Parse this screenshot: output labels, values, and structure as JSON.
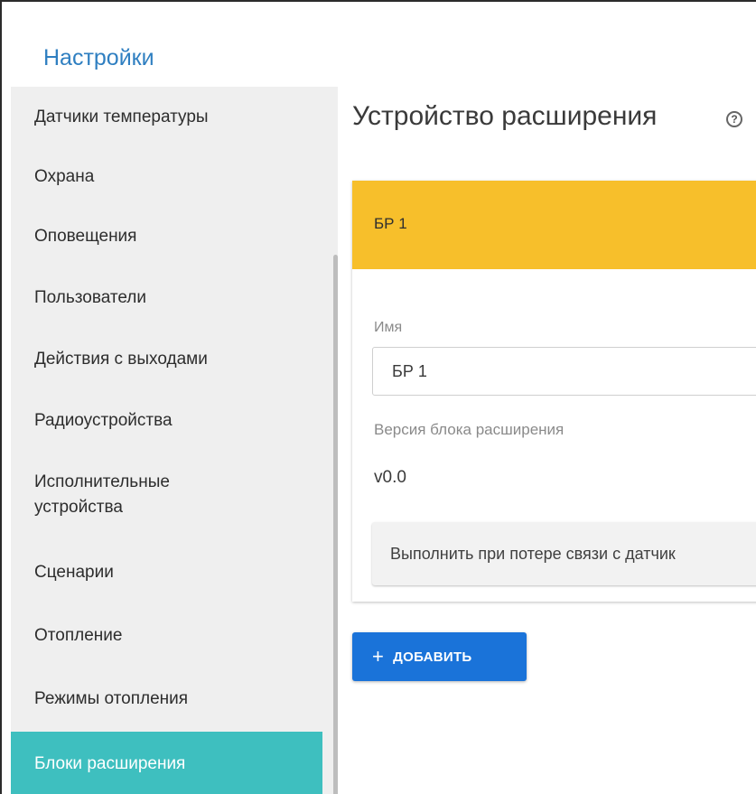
{
  "header": {
    "title": "Настройки"
  },
  "sidebar": {
    "items": [
      {
        "label": "Датчики температуры"
      },
      {
        "label": "Охрана"
      },
      {
        "label": "Оповещения"
      },
      {
        "label": "Пользователи"
      },
      {
        "label": "Действия с выходами"
      },
      {
        "label": "Радиоустройства"
      },
      {
        "label": "Исполнительные\nустройства"
      },
      {
        "label": "Сценарии"
      },
      {
        "label": "Отопление"
      },
      {
        "label": "Режимы отопления"
      },
      {
        "label": "Блоки расширения",
        "active": true
      }
    ]
  },
  "main": {
    "title": "Устройство расширения",
    "help_icon": "help-circle-icon",
    "card": {
      "header_title": "БР 1",
      "header_color": "#f7bf2b",
      "name_label": "Имя",
      "name_value": "БР 1",
      "version_label": "Версия блока расширения",
      "version_value": "v0.0",
      "lost_connection_button": "Выполнить при потере связи с датчик"
    },
    "add_button": {
      "icon": "plus-icon",
      "label": "ДОБАВИТЬ",
      "color": "#1a73d9"
    }
  },
  "colors": {
    "accent": "#3ebfbf",
    "title_blue": "#2f7fc1"
  }
}
